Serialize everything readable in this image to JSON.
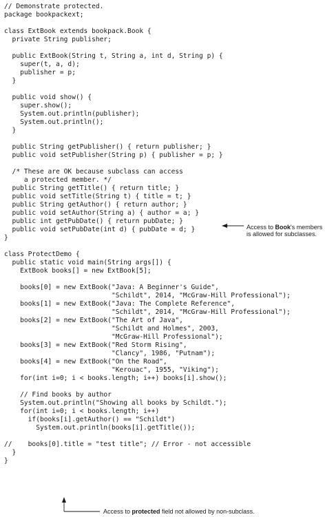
{
  "code_lines": [
    "// Demonstrate protected.",
    "package bookpackext;",
    "",
    "class ExtBook extends bookpack.Book {",
    "  private String publisher;",
    "",
    "  public ExtBook(String t, String a, int d, String p) {",
    "    super(t, a, d);",
    "    publisher = p;",
    "  }",
    "",
    "  public void show() {",
    "    super.show();",
    "    System.out.println(publisher);",
    "    System.out.println();",
    "  }",
    "",
    "  public String getPublisher() { return publisher; }",
    "  public void setPublisher(String p) { publisher = p; }",
    "",
    "  /* These are OK because subclass can access",
    "     a protected member. */",
    "  public String getTitle() { return title; }",
    "  public void setTitle(String t) { title = t; }",
    "  public String getAuthor() { return author; }",
    "  public void setAuthor(String a) { author = a; }",
    "  public int getPubDate() { return pubDate; }",
    "  public void setPubDate(int d) { pubDate = d; }",
    "}",
    "",
    "class ProtectDemo {",
    "  public static void main(String args[]) {",
    "    ExtBook books[] = new ExtBook[5];",
    "",
    "    books[0] = new ExtBook(\"Java: A Beginner's Guide\",",
    "                           \"Schildt\", 2014, \"McGraw-Hill Professional\");",
    "    books[1] = new ExtBook(\"Java: The Complete Reference\",",
    "                           \"Schildt\", 2014, \"McGraw-Hill Professional\");",
    "    books[2] = new ExtBook(\"The Art of Java\",",
    "                           \"Schildt and Holmes\", 2003,",
    "                           \"McGraw-Hill Professional\");",
    "    books[3] = new ExtBook(\"Red Storm Rising\",",
    "                           \"Clancy\", 1986, \"Putnam\");",
    "    books[4] = new ExtBook(\"On the Road\",",
    "                           \"Kerouac\", 1955, \"Viking\");",
    "    for(int i=0; i < books.length; i++) books[i].show();",
    "",
    "    // Find books by author",
    "    System.out.println(\"Showing all books by Schildt.\");",
    "    for(int i=0; i < books.length; i++)",
    "      if(books[i].getAuthor() == \"Schildt\")",
    "        System.out.println(books[i].getTitle());",
    "",
    "//    books[0].title = \"test title\"; // Error - not accessible",
    "  }",
    "}"
  ],
  "annotations": {
    "members_access": {
      "line1_pre": "Access to ",
      "line1_bold": "Book",
      "line1_post": "'s members",
      "line2": "is allowed for subclasses."
    },
    "protected_field": {
      "pre": "Access to ",
      "bold": "protected",
      "post": " field not allowed by non-subclass."
    }
  }
}
